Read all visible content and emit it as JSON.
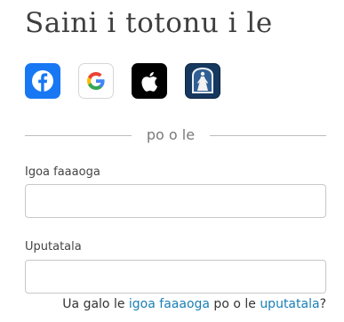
{
  "page": {
    "title": "Saini i totonu i le"
  },
  "social_logins": [
    {
      "provider": "Facebook",
      "icon": "facebook-icon",
      "color": "#1877f2"
    },
    {
      "provider": "Google",
      "icon": "google-icon",
      "color": "#ffffff"
    },
    {
      "provider": "Apple",
      "icon": "apple-icon",
      "color": "#000000"
    },
    {
      "provider": "Church",
      "icon": "church-icon",
      "color": "#16385e"
    }
  ],
  "divider": {
    "text": "po o le"
  },
  "form": {
    "username_label": "Igoa faaaoga",
    "username_value": "",
    "password_label": "Uputatala",
    "password_value": ""
  },
  "help": {
    "prefix": "Ua galo le ",
    "username_link": "igoa faaaoga",
    "middle": " po o le ",
    "password_link": "uputatala",
    "suffix": "?"
  }
}
